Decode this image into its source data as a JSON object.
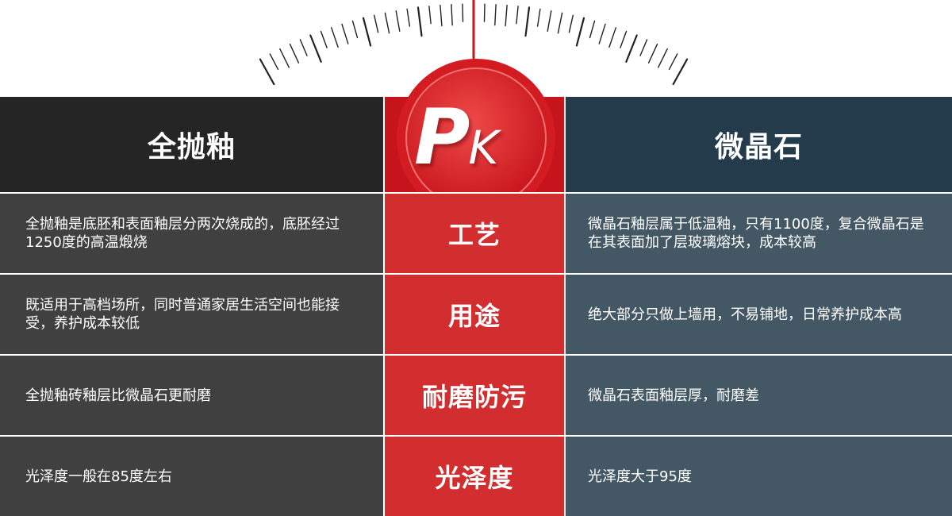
{
  "header": {
    "left_title": "全抛釉",
    "right_title": "微晶石",
    "badge": {
      "big": "P",
      "small": "K"
    }
  },
  "colors": {
    "accent_red": "#c5141c",
    "mid_cell_red": "#d22d2f",
    "left_dark": "#404040",
    "right_slate": "#445764"
  },
  "icons": {
    "gauge": "gauge-scale-icon"
  },
  "rows": [
    {
      "label": "工艺",
      "left": "全抛釉是底胚和表面釉层分两次烧成的，底胚经过1250度的高温煅烧",
      "right": "微晶石釉层属于低温釉，只有1100度，复合微晶石是在其表面加了层玻璃熔块，成本较高"
    },
    {
      "label": "用途",
      "left": "既适用于高档场所，同时普通家居生活空间也能接受，养护成本较低",
      "right": "绝大部分只做上墙用，不易铺地，日常养护成本高"
    },
    {
      "label": "耐磨防污",
      "left": "全抛釉砖釉层比微晶石更耐磨",
      "right": "微晶石表面釉层厚，耐磨差"
    },
    {
      "label": "光泽度",
      "left": "光泽度一般在85度左右",
      "right": "光泽度大于95度"
    }
  ]
}
